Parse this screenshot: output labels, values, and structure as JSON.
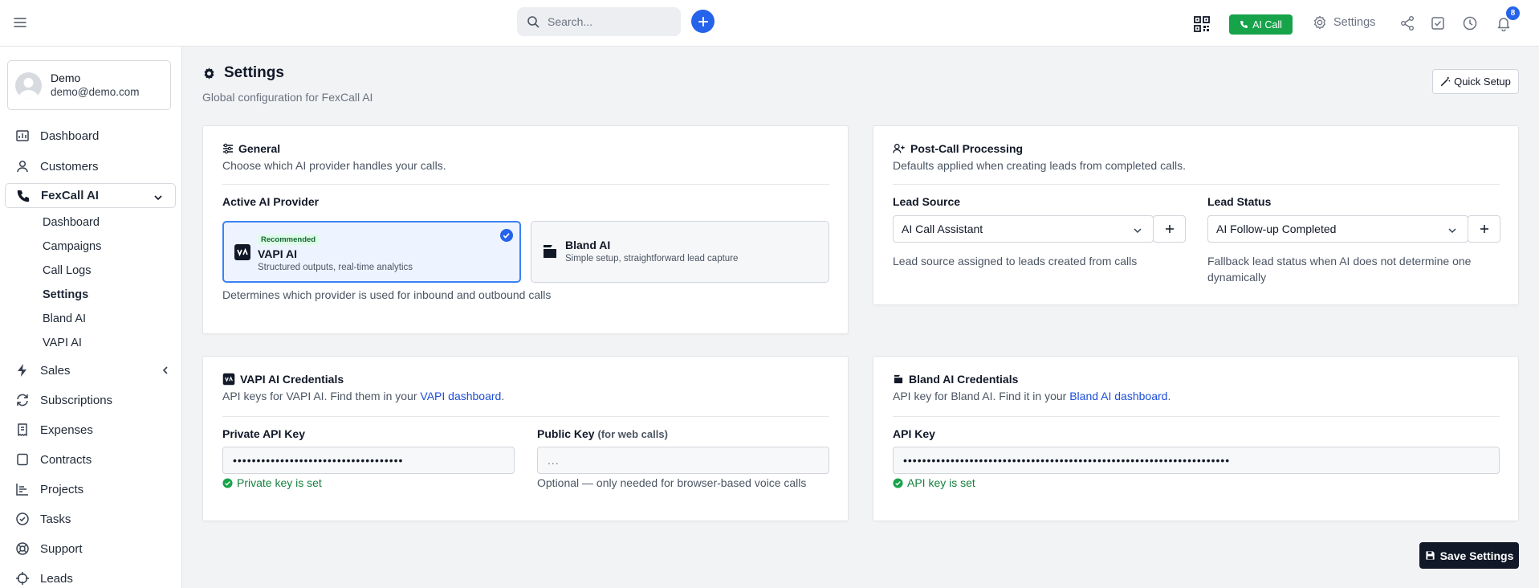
{
  "header": {
    "search_placeholder": "Search...",
    "ai_call_label": "AI Call",
    "settings_label": "Settings",
    "notification_count": "8",
    "accent_color": "#2563eb",
    "call_button_color": "#16a34a"
  },
  "user": {
    "name": "Demo",
    "email": "demo@demo.com"
  },
  "sidebar": {
    "items": [
      {
        "label": "Dashboard",
        "icon": "dashboard-icon"
      },
      {
        "label": "Customers",
        "icon": "user-icon"
      },
      {
        "label": "FexCall AI",
        "icon": "phone-icon",
        "expanded": true
      },
      {
        "label": "Sales",
        "icon": "bolt-icon"
      },
      {
        "label": "Subscriptions",
        "icon": "refresh-icon"
      },
      {
        "label": "Expenses",
        "icon": "receipt-icon"
      },
      {
        "label": "Contracts",
        "icon": "contract-icon"
      },
      {
        "label": "Projects",
        "icon": "chart-icon"
      },
      {
        "label": "Tasks",
        "icon": "check-circle-icon"
      },
      {
        "label": "Support",
        "icon": "lifebuoy-icon"
      },
      {
        "label": "Leads",
        "icon": "crosshair-icon"
      }
    ],
    "fexcall_sub": [
      "Dashboard",
      "Campaigns",
      "Call Logs",
      "Settings",
      "Bland AI",
      "VAPI AI"
    ],
    "current_sub": "Settings"
  },
  "page": {
    "title": "Settings",
    "subtitle": "Global configuration for FexCall AI",
    "quick_setup_label": "Quick Setup",
    "save_label": "Save Settings"
  },
  "general": {
    "title": "General",
    "description": "Choose which AI provider handles your calls.",
    "provider_label": "Active AI Provider",
    "providers": [
      {
        "badge": "Recommended",
        "name": "VAPI AI",
        "desc": "Structured outputs, real-time analytics",
        "selected": true
      },
      {
        "name": "Bland AI",
        "desc": "Simple setup, straightforward lead capture",
        "selected": false
      }
    ],
    "hint": "Determines which provider is used for inbound and outbound calls"
  },
  "post_call": {
    "title": "Post-Call Processing",
    "description": "Defaults applied when creating leads from completed calls.",
    "lead_source_label": "Lead Source",
    "lead_source_value": "AI Call Assistant",
    "lead_source_hint": "Lead source assigned to leads created from calls",
    "lead_status_label": "Lead Status",
    "lead_status_value": "AI Follow-up Completed",
    "lead_status_hint_1": "Fallback lead status when AI does not determine one",
    "lead_status_hint_2": "dynamically"
  },
  "vapi": {
    "title": "VAPI AI Credentials",
    "description_prefix": "API keys for VAPI AI. Find them in your ",
    "link_text": "VAPI dashboard",
    "description_suffix": ".",
    "private_label": "Private API Key",
    "private_value": "••••••••••••••••••••••••••••••••••••",
    "private_status": "Private key is set",
    "public_label": "Public Key",
    "public_note": "(for web calls)",
    "public_placeholder": "...",
    "public_hint": "Optional — only needed for browser-based voice calls"
  },
  "bland": {
    "title": "Bland AI Credentials",
    "description_prefix": "API key for Bland AI. Find it in your ",
    "link_text": "Bland AI dashboard",
    "description_suffix": ".",
    "key_label": "API Key",
    "key_value": "•••••••••••••••••••••••••••••••••••••••••••••••••••••••••••••••••••••",
    "key_status": "API key is set"
  }
}
